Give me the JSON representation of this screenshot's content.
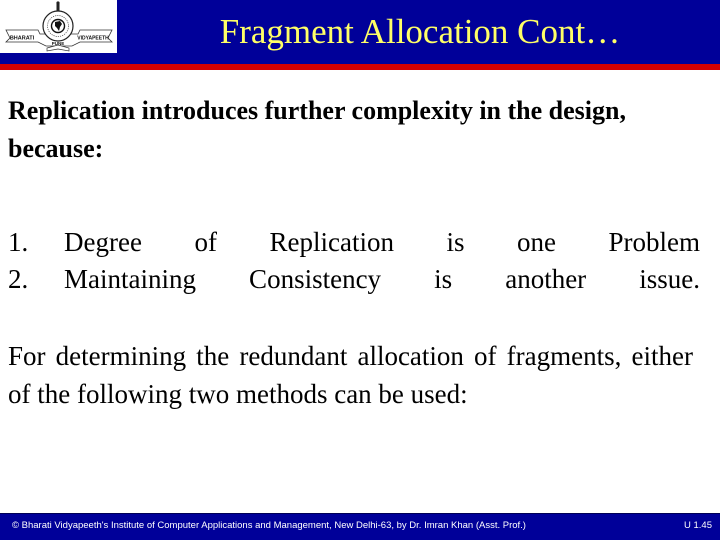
{
  "header": {
    "title": "Fragment Allocation Cont…",
    "logo": {
      "left_text": "BHARATI",
      "right_text": "VIDYAPEETH",
      "bottom_text": "PUNE"
    }
  },
  "content": {
    "intro": "Replication introduces further complexity in the design, because:",
    "list": [
      {
        "number": "1.",
        "text": "Degree of Replication is one Problem"
      },
      {
        "number": "2.",
        "text": "Maintaining Consistency is another issue."
      }
    ],
    "paragraph": "For determining the redundant allocation of fragments, either of the following two methods can be used:"
  },
  "footer": {
    "copyright": "© Bharati Vidyapeeth's Institute of Computer Applications and Management, New Delhi-63,  by  Dr. Imran Khan (Asst. Prof.)",
    "page_label": "U 1.45"
  },
  "colors": {
    "header_bg": "#000099",
    "header_stripe": "#d40000",
    "title_text": "#ffff66",
    "footer_bg": "#000099",
    "footer_text": "#ffffff"
  }
}
